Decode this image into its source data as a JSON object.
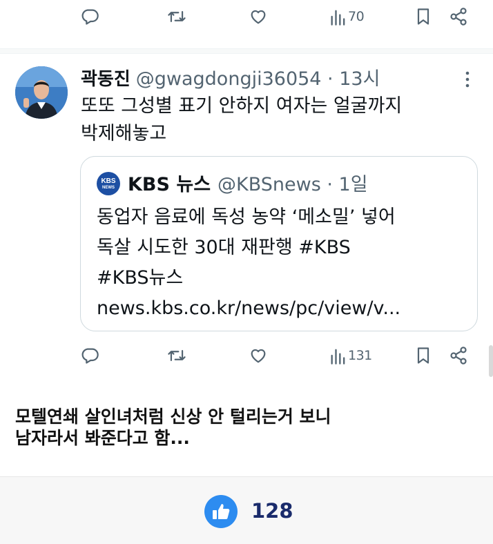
{
  "top_actions": {
    "views": "70"
  },
  "tweet": {
    "name": "곽동진",
    "handle_time": "@gwagdongji36054 · 13시",
    "text_line1": "또또 그성별 표기 안하지 여자는 얼굴까지",
    "text_line2": "박제해놓고",
    "quote": {
      "logo_line1": "KBS",
      "logo_line2": "NEWS",
      "name": "KBS 뉴스",
      "handle_time": "@KBSnews · 1일",
      "line1": "동업자 음료에 독성 농약 ‘메소밀’ 넣어",
      "line2": "독살 시도한 30대 재판행 #KBS",
      "line3": "#KBS뉴스",
      "line4": "news.kbs.co.kr/news/pc/view/v..."
    },
    "views": "131"
  },
  "comment": {
    "line1": "모텔연쇄 살인녀처럼 신상 안 털리는거 보니",
    "line2": "남자라서 봐준다고 함..."
  },
  "like": {
    "count": "128"
  },
  "colors": {
    "accent": "#2d8cf0",
    "icon": "#536471",
    "border": "#cfd9de"
  }
}
